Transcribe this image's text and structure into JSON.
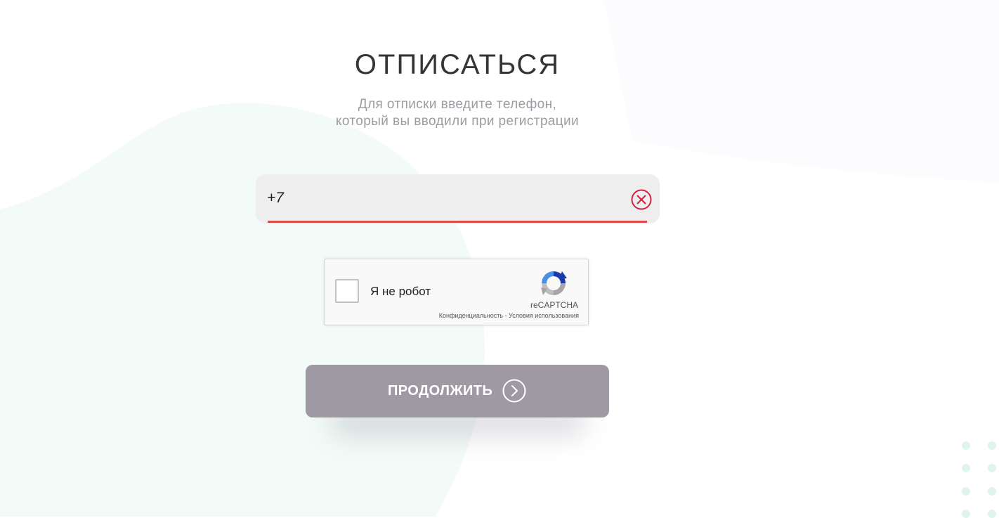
{
  "page": {
    "title": "ОТПИСАТЬСЯ",
    "subtitle_line1": "Для отписки введите телефон,",
    "subtitle_line2": "который вы вводили при регистрации"
  },
  "phone_field": {
    "value": "+7",
    "clear_icon": "close-circle-icon",
    "error_color": "#df4b4b"
  },
  "recaptcha": {
    "checkbox_label": "Я не робот",
    "brand": "reCAPTCHA",
    "privacy_link": "Конфиденциальность",
    "separator": " - ",
    "terms_link": "Условия использования",
    "logo_icon": "recaptcha-logo-icon"
  },
  "continue_button": {
    "label": "ПРОДОЛЖИТЬ",
    "icon": "chevron-right-circle-icon",
    "color": "#9e99a3"
  },
  "colors": {
    "title": "#333538",
    "subtitle": "#9a9da1",
    "field_bg": "#eeeeef",
    "decor": "#dff4ee"
  }
}
